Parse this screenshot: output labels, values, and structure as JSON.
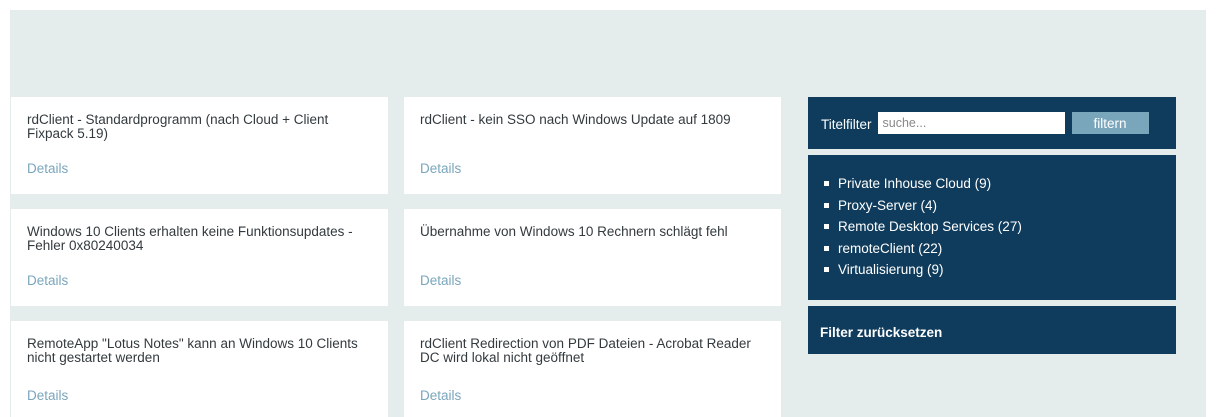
{
  "articles": [
    {
      "title": "rdClient - Standardprogramm (nach Cloud + Client Fixpack 5.19)",
      "link_label": "Details"
    },
    {
      "title": "rdClient - kein SSO nach Windows Update auf 1809",
      "link_label": "Details"
    },
    {
      "title": "Windows 10 Clients erhalten keine Funktionsupdates - Fehler 0x80240034",
      "link_label": "Details"
    },
    {
      "title": "Übernahme von Windows 10 Rechnern schlägt fehl",
      "link_label": "Details"
    },
    {
      "title": "RemoteApp \"Lotus Notes\" kann an Windows 10 Clients nicht gestartet werden",
      "link_label": "Details"
    },
    {
      "title": "rdClient Redirection von PDF Dateien - Acrobat Reader DC wird lokal nicht geöffnet",
      "link_label": "Details"
    }
  ],
  "sidebar": {
    "filter": {
      "label": "Titelfilter",
      "placeholder": "suche...",
      "button_label": "filtern"
    },
    "categories": [
      {
        "label": "Private Inhouse Cloud (9)"
      },
      {
        "label": "Proxy-Server (4)"
      },
      {
        "label": "Remote Desktop Services (27)"
      },
      {
        "label": "remoteClient (22)"
      },
      {
        "label": "Virtualisierung (9)"
      }
    ],
    "reset_label": "Filter zurücksetzen"
  },
  "colors": {
    "page_background": "#e4ecec",
    "panel_background": "#0f3c5c",
    "link": "#7aa6bc",
    "button": "#7aa6bc",
    "card_background": "#ffffff"
  }
}
